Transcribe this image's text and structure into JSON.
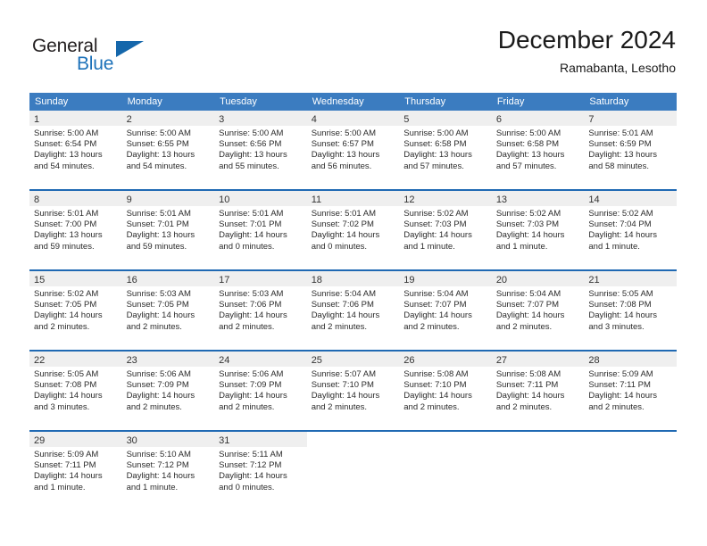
{
  "branding": {
    "name_part1": "General",
    "name_part2": "Blue"
  },
  "header": {
    "title": "December 2024",
    "subtitle": "Ramabanta, Lesotho"
  },
  "colors": {
    "header_blue": "#3b7cc0",
    "row_divider_blue": "#1f69b3",
    "daynum_band": "#efefef",
    "logo_blue": "#1567ab"
  },
  "weekdays": [
    "Sunday",
    "Monday",
    "Tuesday",
    "Wednesday",
    "Thursday",
    "Friday",
    "Saturday"
  ],
  "weeks": [
    [
      {
        "day": "1",
        "sunrise": "Sunrise: 5:00 AM",
        "sunset": "Sunset: 6:54 PM",
        "daylight1": "Daylight: 13 hours",
        "daylight2": "and 54 minutes."
      },
      {
        "day": "2",
        "sunrise": "Sunrise: 5:00 AM",
        "sunset": "Sunset: 6:55 PM",
        "daylight1": "Daylight: 13 hours",
        "daylight2": "and 54 minutes."
      },
      {
        "day": "3",
        "sunrise": "Sunrise: 5:00 AM",
        "sunset": "Sunset: 6:56 PM",
        "daylight1": "Daylight: 13 hours",
        "daylight2": "and 55 minutes."
      },
      {
        "day": "4",
        "sunrise": "Sunrise: 5:00 AM",
        "sunset": "Sunset: 6:57 PM",
        "daylight1": "Daylight: 13 hours",
        "daylight2": "and 56 minutes."
      },
      {
        "day": "5",
        "sunrise": "Sunrise: 5:00 AM",
        "sunset": "Sunset: 6:58 PM",
        "daylight1": "Daylight: 13 hours",
        "daylight2": "and 57 minutes."
      },
      {
        "day": "6",
        "sunrise": "Sunrise: 5:00 AM",
        "sunset": "Sunset: 6:58 PM",
        "daylight1": "Daylight: 13 hours",
        "daylight2": "and 57 minutes."
      },
      {
        "day": "7",
        "sunrise": "Sunrise: 5:01 AM",
        "sunset": "Sunset: 6:59 PM",
        "daylight1": "Daylight: 13 hours",
        "daylight2": "and 58 minutes."
      }
    ],
    [
      {
        "day": "8",
        "sunrise": "Sunrise: 5:01 AM",
        "sunset": "Sunset: 7:00 PM",
        "daylight1": "Daylight: 13 hours",
        "daylight2": "and 59 minutes."
      },
      {
        "day": "9",
        "sunrise": "Sunrise: 5:01 AM",
        "sunset": "Sunset: 7:01 PM",
        "daylight1": "Daylight: 13 hours",
        "daylight2": "and 59 minutes."
      },
      {
        "day": "10",
        "sunrise": "Sunrise: 5:01 AM",
        "sunset": "Sunset: 7:01 PM",
        "daylight1": "Daylight: 14 hours",
        "daylight2": "and 0 minutes."
      },
      {
        "day": "11",
        "sunrise": "Sunrise: 5:01 AM",
        "sunset": "Sunset: 7:02 PM",
        "daylight1": "Daylight: 14 hours",
        "daylight2": "and 0 minutes."
      },
      {
        "day": "12",
        "sunrise": "Sunrise: 5:02 AM",
        "sunset": "Sunset: 7:03 PM",
        "daylight1": "Daylight: 14 hours",
        "daylight2": "and 1 minute."
      },
      {
        "day": "13",
        "sunrise": "Sunrise: 5:02 AM",
        "sunset": "Sunset: 7:03 PM",
        "daylight1": "Daylight: 14 hours",
        "daylight2": "and 1 minute."
      },
      {
        "day": "14",
        "sunrise": "Sunrise: 5:02 AM",
        "sunset": "Sunset: 7:04 PM",
        "daylight1": "Daylight: 14 hours",
        "daylight2": "and 1 minute."
      }
    ],
    [
      {
        "day": "15",
        "sunrise": "Sunrise: 5:02 AM",
        "sunset": "Sunset: 7:05 PM",
        "daylight1": "Daylight: 14 hours",
        "daylight2": "and 2 minutes."
      },
      {
        "day": "16",
        "sunrise": "Sunrise: 5:03 AM",
        "sunset": "Sunset: 7:05 PM",
        "daylight1": "Daylight: 14 hours",
        "daylight2": "and 2 minutes."
      },
      {
        "day": "17",
        "sunrise": "Sunrise: 5:03 AM",
        "sunset": "Sunset: 7:06 PM",
        "daylight1": "Daylight: 14 hours",
        "daylight2": "and 2 minutes."
      },
      {
        "day": "18",
        "sunrise": "Sunrise: 5:04 AM",
        "sunset": "Sunset: 7:06 PM",
        "daylight1": "Daylight: 14 hours",
        "daylight2": "and 2 minutes."
      },
      {
        "day": "19",
        "sunrise": "Sunrise: 5:04 AM",
        "sunset": "Sunset: 7:07 PM",
        "daylight1": "Daylight: 14 hours",
        "daylight2": "and 2 minutes."
      },
      {
        "day": "20",
        "sunrise": "Sunrise: 5:04 AM",
        "sunset": "Sunset: 7:07 PM",
        "daylight1": "Daylight: 14 hours",
        "daylight2": "and 2 minutes."
      },
      {
        "day": "21",
        "sunrise": "Sunrise: 5:05 AM",
        "sunset": "Sunset: 7:08 PM",
        "daylight1": "Daylight: 14 hours",
        "daylight2": "and 3 minutes."
      }
    ],
    [
      {
        "day": "22",
        "sunrise": "Sunrise: 5:05 AM",
        "sunset": "Sunset: 7:08 PM",
        "daylight1": "Daylight: 14 hours",
        "daylight2": "and 3 minutes."
      },
      {
        "day": "23",
        "sunrise": "Sunrise: 5:06 AM",
        "sunset": "Sunset: 7:09 PM",
        "daylight1": "Daylight: 14 hours",
        "daylight2": "and 2 minutes."
      },
      {
        "day": "24",
        "sunrise": "Sunrise: 5:06 AM",
        "sunset": "Sunset: 7:09 PM",
        "daylight1": "Daylight: 14 hours",
        "daylight2": "and 2 minutes."
      },
      {
        "day": "25",
        "sunrise": "Sunrise: 5:07 AM",
        "sunset": "Sunset: 7:10 PM",
        "daylight1": "Daylight: 14 hours",
        "daylight2": "and 2 minutes."
      },
      {
        "day": "26",
        "sunrise": "Sunrise: 5:08 AM",
        "sunset": "Sunset: 7:10 PM",
        "daylight1": "Daylight: 14 hours",
        "daylight2": "and 2 minutes."
      },
      {
        "day": "27",
        "sunrise": "Sunrise: 5:08 AM",
        "sunset": "Sunset: 7:11 PM",
        "daylight1": "Daylight: 14 hours",
        "daylight2": "and 2 minutes."
      },
      {
        "day": "28",
        "sunrise": "Sunrise: 5:09 AM",
        "sunset": "Sunset: 7:11 PM",
        "daylight1": "Daylight: 14 hours",
        "daylight2": "and 2 minutes."
      }
    ],
    [
      {
        "day": "29",
        "sunrise": "Sunrise: 5:09 AM",
        "sunset": "Sunset: 7:11 PM",
        "daylight1": "Daylight: 14 hours",
        "daylight2": "and 1 minute."
      },
      {
        "day": "30",
        "sunrise": "Sunrise: 5:10 AM",
        "sunset": "Sunset: 7:12 PM",
        "daylight1": "Daylight: 14 hours",
        "daylight2": "and 1 minute."
      },
      {
        "day": "31",
        "sunrise": "Sunrise: 5:11 AM",
        "sunset": "Sunset: 7:12 PM",
        "daylight1": "Daylight: 14 hours",
        "daylight2": "and 0 minutes."
      },
      {
        "day": "",
        "sunrise": "",
        "sunset": "",
        "daylight1": "",
        "daylight2": ""
      },
      {
        "day": "",
        "sunrise": "",
        "sunset": "",
        "daylight1": "",
        "daylight2": ""
      },
      {
        "day": "",
        "sunrise": "",
        "sunset": "",
        "daylight1": "",
        "daylight2": ""
      },
      {
        "day": "",
        "sunrise": "",
        "sunset": "",
        "daylight1": "",
        "daylight2": ""
      }
    ]
  ]
}
